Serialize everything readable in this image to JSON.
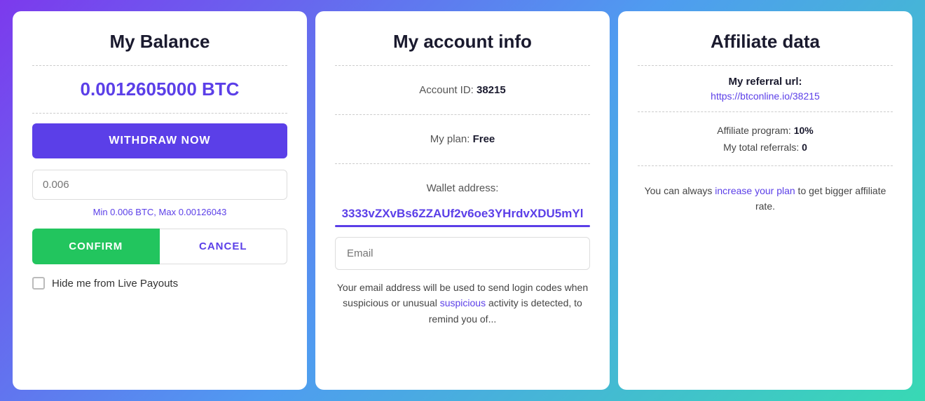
{
  "left": {
    "title": "My Balance",
    "balance": "0.0012605000 BTC",
    "withdraw_label": "WITHDRAW NOW",
    "amount_placeholder": "0.006",
    "min_max": "Min 0.006 BTC, Max 0.00126043",
    "confirm_label": "CONFIRM",
    "cancel_label": "CANCEL",
    "hide_label": "Hide me from Live Payouts"
  },
  "middle": {
    "title": "My account info",
    "account_id_label": "Account ID:",
    "account_id_value": "38215",
    "plan_label": "My plan:",
    "plan_value": "Free",
    "wallet_label": "Wallet address:",
    "wallet_value": "3333vZXvBs6ZZAUf2v6oe3YHrdvXDU5mYl",
    "email_placeholder": "Email",
    "email_desc_1": "Your email address will be used to send login codes when suspicious or unusual",
    "email_desc_2": "activity is detected, to remind you of..."
  },
  "right": {
    "title": "Affiliate data",
    "referral_label": "My referral url:",
    "referral_url": "https://btconline.io/38215",
    "affiliate_program_label": "Affiliate program:",
    "affiliate_program_value": "10%",
    "total_referrals_label": "My total referrals:",
    "total_referrals_value": "0",
    "increase_text_1": "You can always ",
    "increase_link": "increase your plan",
    "increase_text_2": " to get bigger affiliate rate."
  }
}
